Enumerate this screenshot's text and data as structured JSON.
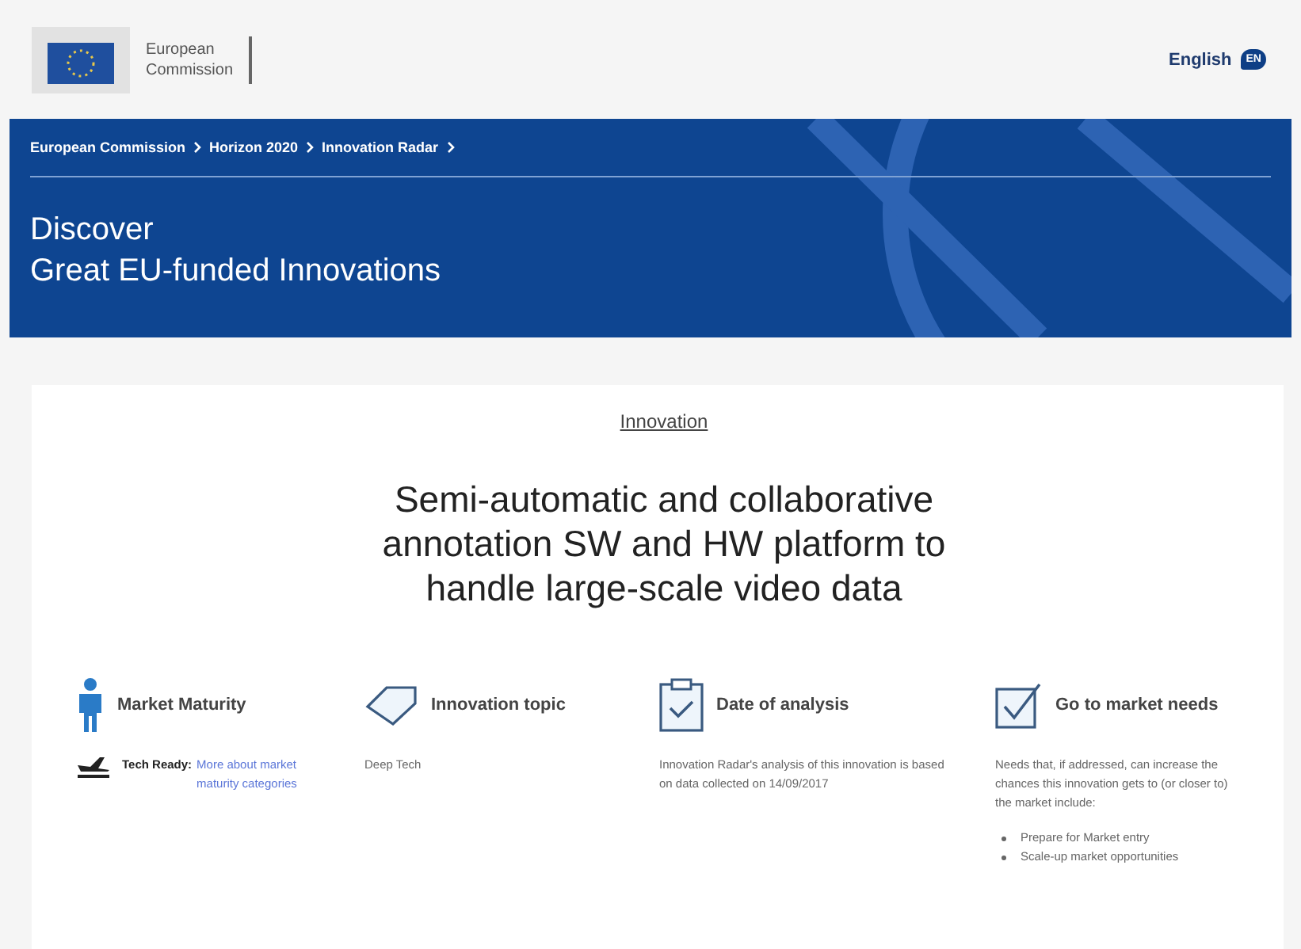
{
  "header": {
    "logo_text": [
      "European",
      "Commission"
    ],
    "language": "English",
    "language_code": "EN"
  },
  "breadcrumb": [
    "European Commission",
    "Horizon 2020",
    "Innovation Radar"
  ],
  "banner": {
    "lines": [
      "Discover",
      "Great EU-funded Innovations"
    ]
  },
  "card": {
    "section_label": "Innovation",
    "title": "Semi-automatic and collaborative annotation SW and HW platform to handle large-scale video data",
    "columns": [
      {
        "kind": "maturity",
        "heading": "Market Maturity",
        "label": "Tech Ready:",
        "link": "More about market maturity categories"
      },
      {
        "kind": "topic",
        "heading": "Innovation topic",
        "text": "Deep Tech"
      },
      {
        "kind": "date",
        "heading": "Date of analysis",
        "text": "Innovation Radar's analysis of this innovation is based on data collected on 14/09/2017"
      },
      {
        "kind": "needs",
        "heading": "Go to market needs",
        "text": "Needs that, if addressed, can increase the chances this innovation gets to (or closer to) the market include:",
        "items": [
          "Prepare for Market entry",
          "Scale-up market opportunities"
        ]
      }
    ]
  }
}
